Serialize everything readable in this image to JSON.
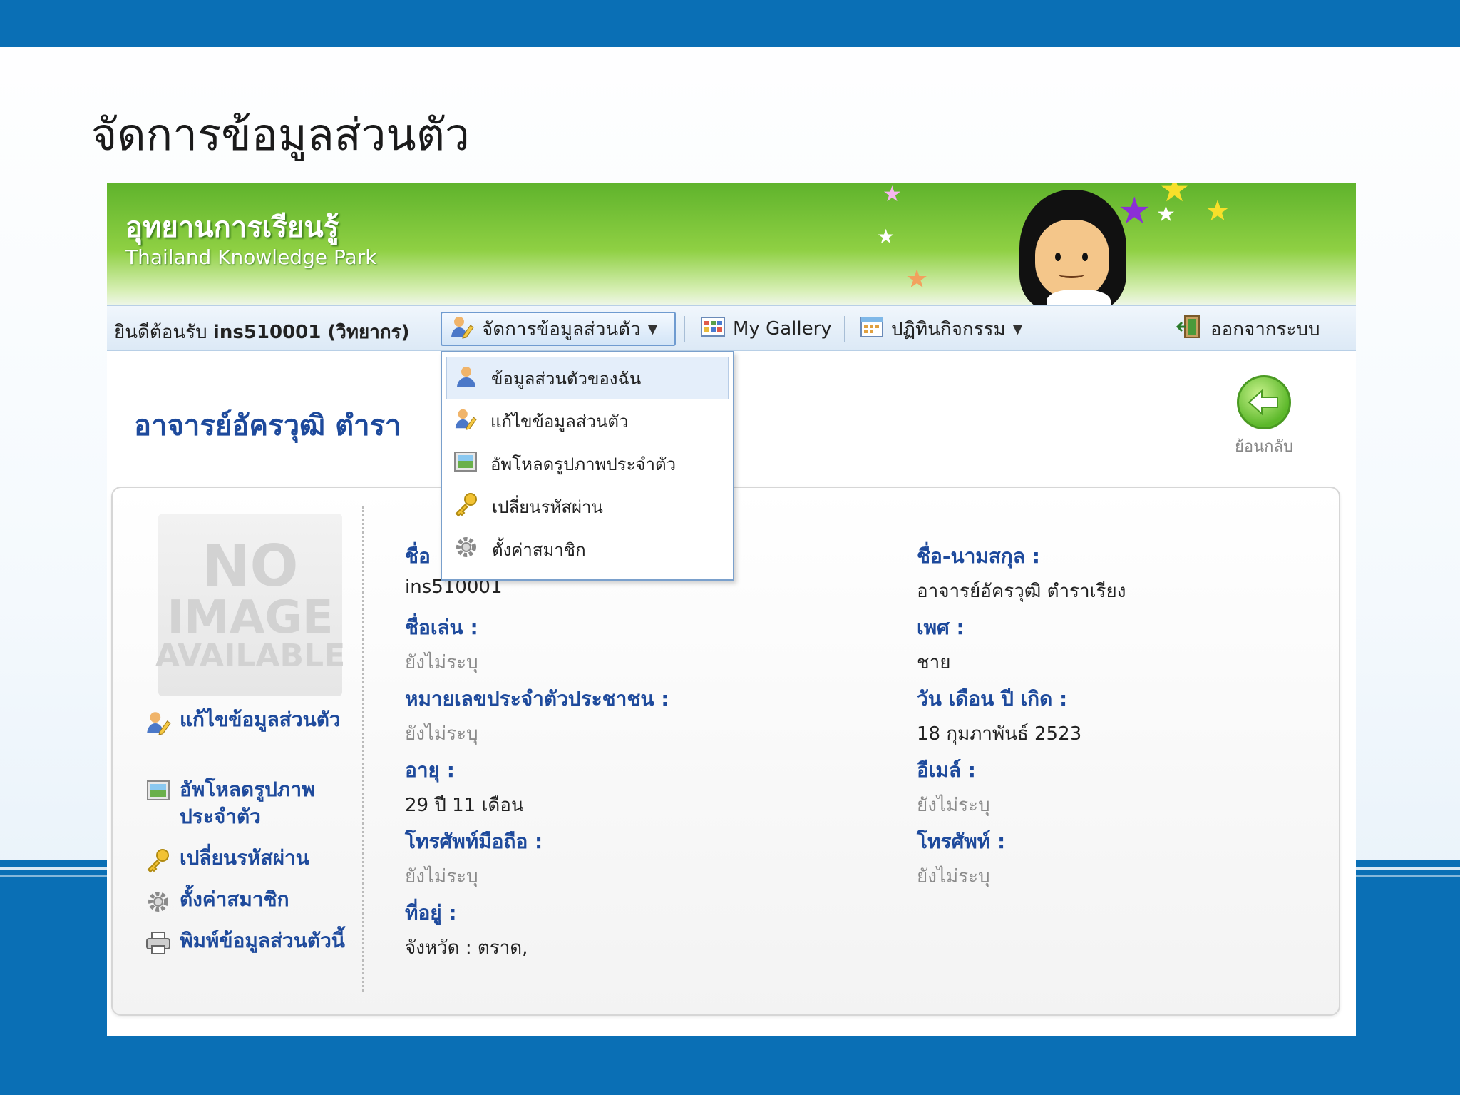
{
  "slide": {
    "title": "จัดการข้อมูลส่วนตัว"
  },
  "brand": {
    "name_th": "อุทยานการเรียนรู้",
    "name_en": "Thailand Knowledge Park"
  },
  "nav": {
    "welcome_prefix": "ยินดีต้อนรับ",
    "username": "ins510001 (วิทยากร)",
    "items": [
      {
        "label": "จัดการข้อมูลส่วนตัว",
        "icon": "user-edit-icon",
        "has_caret": true,
        "active": true
      },
      {
        "label": "My Gallery",
        "icon": "gallery-icon"
      },
      {
        "label": "ปฏิทินกิจกรรม",
        "icon": "calendar-icon",
        "has_caret": true
      },
      {
        "label": "ออกจากระบบ",
        "icon": "logout-icon"
      }
    ]
  },
  "dropdown": {
    "items": [
      {
        "label": "ข้อมูลส่วนตัวของฉัน",
        "icon": "user-icon",
        "highlighted": true
      },
      {
        "label": "แก้ไขข้อมูลส่วนตัว",
        "icon": "user-edit-icon"
      },
      {
        "label": "อัพโหลดรูปภาพประจำตัว",
        "icon": "picture-icon"
      },
      {
        "label": "เปลี่ยนรหัสผ่าน",
        "icon": "key-icon"
      },
      {
        "label": "ตั้งค่าสมาชิก",
        "icon": "gear-icon"
      }
    ]
  },
  "page": {
    "name": "อาจารย์อัครวุฒิ ตำรา",
    "back_label": "ย้อนกลับ"
  },
  "profile": {
    "no_image": {
      "line1": "NO",
      "line2": "IMAGE",
      "line3": "AVAILABLE"
    },
    "side_links": [
      {
        "label": "แก้ไขข้อมูลส่วนตัว",
        "icon": "user-edit-icon"
      },
      {
        "label": "อัพโหลดรูปภาพประจำตัว",
        "icon": "picture-icon"
      },
      {
        "label": "เปลี่ยนรหัสผ่าน",
        "icon": "key-icon"
      },
      {
        "label": "ตั้งค่าสมาชิก",
        "icon": "gear-icon"
      },
      {
        "label": "พิมพ์ข้อมูลส่วนตัวนี้",
        "icon": "printer-icon"
      }
    ],
    "left_fields": [
      {
        "label": "ชื่อ",
        "value": "ins510001",
        "muted": false
      },
      {
        "label": "ชื่อเล่น :",
        "value": "ยังไม่ระบุ",
        "muted": true
      },
      {
        "label": "หมายเลขประจำตัวประชาชน :",
        "value": "ยังไม่ระบุ",
        "muted": true
      },
      {
        "label": "อายุ :",
        "value": "29 ปี 11 เดือน",
        "muted": false
      },
      {
        "label": "โทรศัพท์มือถือ :",
        "value": "ยังไม่ระบุ",
        "muted": true
      },
      {
        "label": "ที่อยู่ :",
        "value": "จังหวัด : ตราด,",
        "muted": false
      }
    ],
    "right_fields": [
      {
        "label": "ชื่อ-นามสกุล :",
        "value": "อาจารย์อัครวุฒิ ตำราเรียง",
        "muted": false
      },
      {
        "label": "เพศ :",
        "value": "ชาย",
        "muted": false
      },
      {
        "label": "วัน เดือน ปี เกิด :",
        "value": "18 กุมภาพันธ์ 2523",
        "muted": false
      },
      {
        "label": "อีเมล์ :",
        "value": "ยังไม่ระบุ",
        "muted": true
      },
      {
        "label": "โทรศัพท์ :",
        "value": "ยังไม่ระบุ",
        "muted": true
      }
    ]
  },
  "colors": {
    "slide_blue": "#0a6fb5",
    "label_blue": "#1e4a9c",
    "banner_green": "#6cbd31"
  }
}
